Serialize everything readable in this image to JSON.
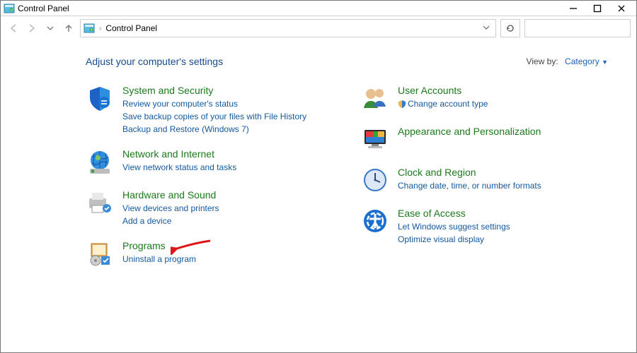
{
  "titlebar": {
    "title": "Control Panel"
  },
  "breadcrumb": {
    "root": "Control Panel"
  },
  "content": {
    "heading": "Adjust your computer's settings",
    "viewby_label": "View by:",
    "viewby_value": "Category"
  },
  "left": [
    {
      "title": "System and Security",
      "links": [
        "Review your computer's status",
        "Save backup copies of your files with File History",
        "Backup and Restore (Windows 7)"
      ]
    },
    {
      "title": "Network and Internet",
      "links": [
        "View network status and tasks"
      ]
    },
    {
      "title": "Hardware and Sound",
      "links": [
        "View devices and printers",
        "Add a device"
      ]
    },
    {
      "title": "Programs",
      "links": [
        "Uninstall a program"
      ]
    }
  ],
  "right": [
    {
      "title": "User Accounts",
      "links": [
        "Change account type"
      ],
      "shield": [
        true
      ]
    },
    {
      "title": "Appearance and Personalization",
      "links": []
    },
    {
      "title": "Clock and Region",
      "links": [
        "Change date, time, or number formats"
      ]
    },
    {
      "title": "Ease of Access",
      "links": [
        "Let Windows suggest settings",
        "Optimize visual display"
      ]
    }
  ]
}
